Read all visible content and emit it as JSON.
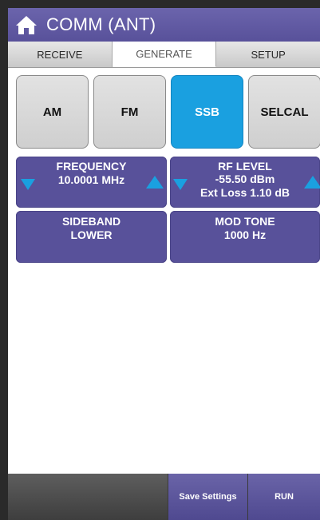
{
  "titlebar": {
    "title": "COMM (ANT)",
    "home_icon": "home-icon"
  },
  "tabs": [
    {
      "label": "RECEIVE",
      "active": false
    },
    {
      "label": "GENERATE",
      "active": true
    },
    {
      "label": "SETUP",
      "active": false
    }
  ],
  "modes": [
    {
      "label": "AM",
      "selected": false
    },
    {
      "label": "FM",
      "selected": false
    },
    {
      "label": "SSB",
      "selected": true
    },
    {
      "label": "SELCAL",
      "selected": false
    }
  ],
  "frequency": {
    "title": "FREQUENCY",
    "value": "10.0001 MHz"
  },
  "rf_level": {
    "title": "RF LEVEL",
    "value": "-55.50 dBm",
    "ext_loss": "Ext Loss 1.10 dB"
  },
  "sideband": {
    "title": "SIDEBAND",
    "value": "LOWER"
  },
  "mod_tone": {
    "title": "MOD TONE",
    "value": "1000 Hz"
  },
  "bottom": {
    "save_label": "Save Settings",
    "run_label": "RUN"
  },
  "colors": {
    "accent": "#58519a",
    "selected": "#1aa0e0",
    "arrow": "#1aa0e0"
  }
}
